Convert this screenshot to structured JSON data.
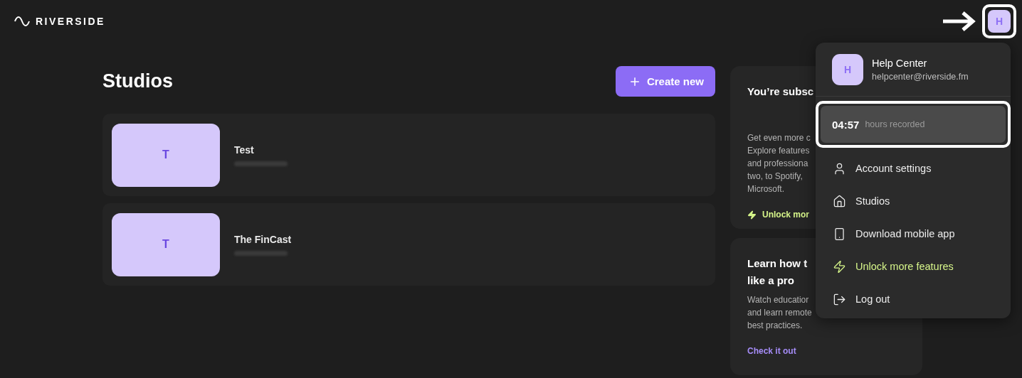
{
  "header": {
    "logo": "RIVERSIDE",
    "avatar": "H"
  },
  "studios": {
    "title": "Studios",
    "create_button": "Create new",
    "items": [
      {
        "thumb": "T",
        "name": "Test"
      },
      {
        "thumb": "T",
        "name": "The FinCast"
      }
    ]
  },
  "side_cards": [
    {
      "kind": "upgrade",
      "title": "You’re subsc",
      "lines": [
        "Get even more c",
        "Explore features",
        "and professiona",
        "two, to Spotify,",
        "Microsoft."
      ],
      "link": "Unlock mor"
    },
    {
      "kind": "learn",
      "title": "Learn how t",
      "title_2": "like a pro",
      "lines": [
        "Watch educatior",
        "and learn remote",
        "best practices."
      ],
      "link": "Check it out"
    }
  ],
  "menu": {
    "avatar": "H",
    "name": "Help Center",
    "email": "helpcenter@riverside.fm",
    "hours": "04:57",
    "hours_label": "hours recorded",
    "items": [
      {
        "kind": "account",
        "label": "Account settings"
      },
      {
        "kind": "studios",
        "label": "Studios"
      },
      {
        "kind": "mobile",
        "label": "Download mobile app"
      },
      {
        "kind": "unlock",
        "label": "Unlock more features"
      },
      {
        "kind": "logout",
        "label": "Log out"
      }
    ]
  }
}
